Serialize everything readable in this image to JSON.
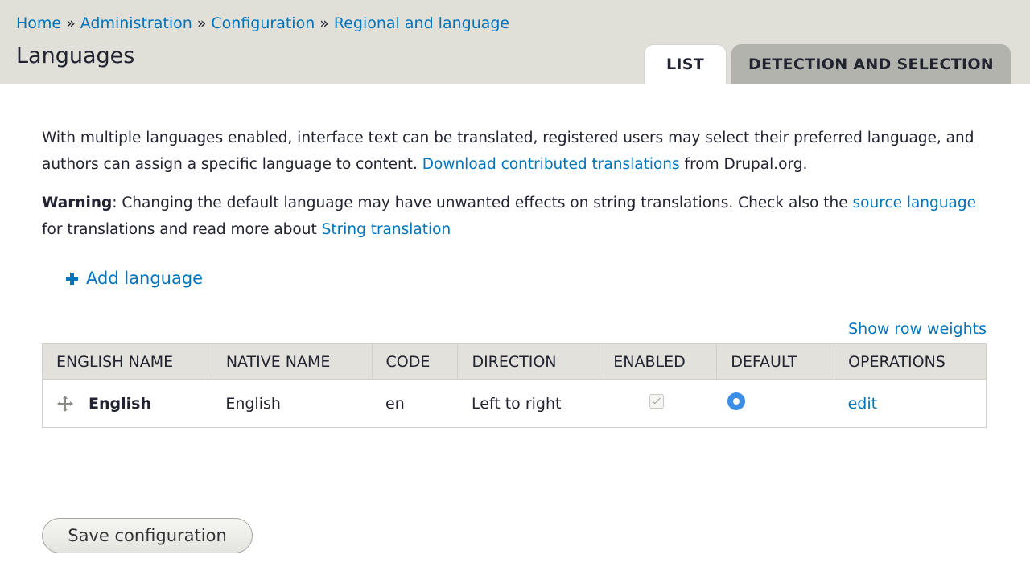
{
  "breadcrumb": {
    "items": [
      "Home",
      "Administration",
      "Configuration",
      "Regional and language"
    ],
    "separator": "»"
  },
  "page": {
    "title": "Languages"
  },
  "tabs": [
    {
      "label": "LIST",
      "active": true
    },
    {
      "label": "DETECTION AND SELECTION",
      "active": false
    }
  ],
  "intro": {
    "text_before": "With multiple languages enabled, interface text can be translated, registered users may select their preferred language, and authors can assign a specific language to content. ",
    "link": "Download contributed translations",
    "text_after": " from Drupal.org."
  },
  "warning": {
    "label": "Warning",
    "text_before": ": Changing the default language may have unwanted effects on string translations. Check also the ",
    "link1": "source language",
    "text_middle": " for translations and read more about ",
    "link2": "String translation"
  },
  "add_language": {
    "label": "Add language",
    "icon": "plus-icon"
  },
  "show_row_weights": "Show row weights",
  "table": {
    "headers": [
      "ENGLISH NAME",
      "NATIVE NAME",
      "CODE",
      "DIRECTION",
      "ENABLED",
      "DEFAULT",
      "OPERATIONS"
    ],
    "rows": [
      {
        "english_name": "English",
        "native_name": "English",
        "code": "en",
        "direction": "Left to right",
        "enabled": true,
        "default": true,
        "operation": "edit"
      }
    ]
  },
  "save_button": "Save configuration",
  "colors": {
    "link": "#0074bd",
    "header_bg": "#e0dfd8",
    "radio": "#3b8de8"
  }
}
